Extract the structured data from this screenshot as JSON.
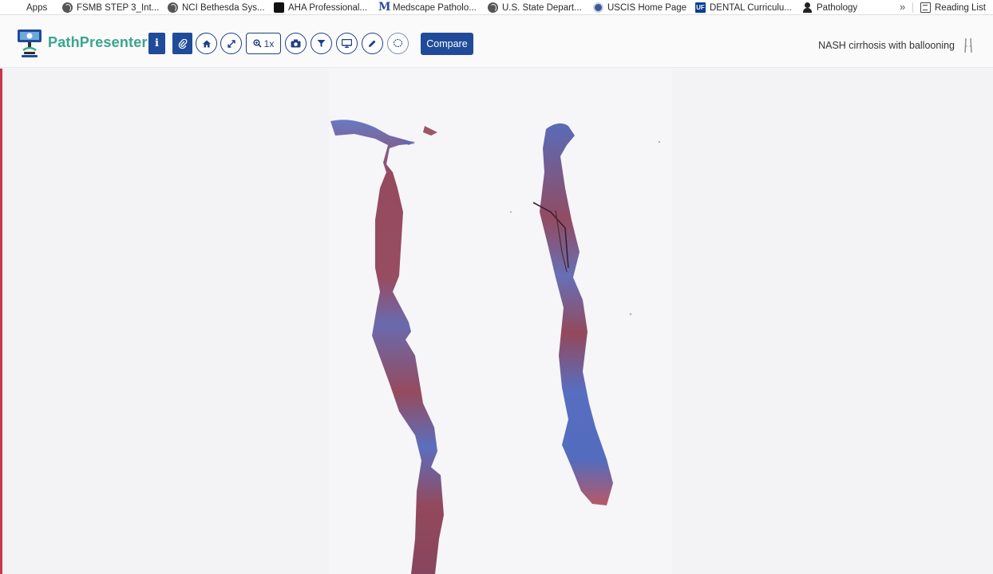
{
  "bookmarks": {
    "items": [
      {
        "label": "Apps",
        "icon": "apps-grid-icon"
      },
      {
        "label": "FSMB STEP 3_Int...",
        "icon": "globe-icon"
      },
      {
        "label": "NCI Bethesda Sys...",
        "icon": "globe-icon"
      },
      {
        "label": "AHA Professional...",
        "icon": "aha-icon"
      },
      {
        "label": "Medscape Patholo...",
        "icon": "medscape-icon"
      },
      {
        "label": "U.S. State Depart...",
        "icon": "globe-icon"
      },
      {
        "label": "USCIS Home Page",
        "icon": "seal-icon"
      },
      {
        "label": "DENTAL Curriculu...",
        "icon": "uf-icon"
      },
      {
        "label": "Pathology",
        "icon": "person-icon"
      }
    ],
    "overflow": "»",
    "reading_list": "Reading List"
  },
  "toolbar": {
    "brand": "PathPresenter",
    "zoom_label": "1x",
    "compare_label": "Compare",
    "case_title": "NASH cirrhosis with ballooning",
    "accent_color": "#1f4b99",
    "brand_color": "#3aa58d"
  },
  "viewer": {
    "stain_colors": {
      "collagen": "#4a63b3",
      "tissue": "#8e3a4d"
    }
  }
}
